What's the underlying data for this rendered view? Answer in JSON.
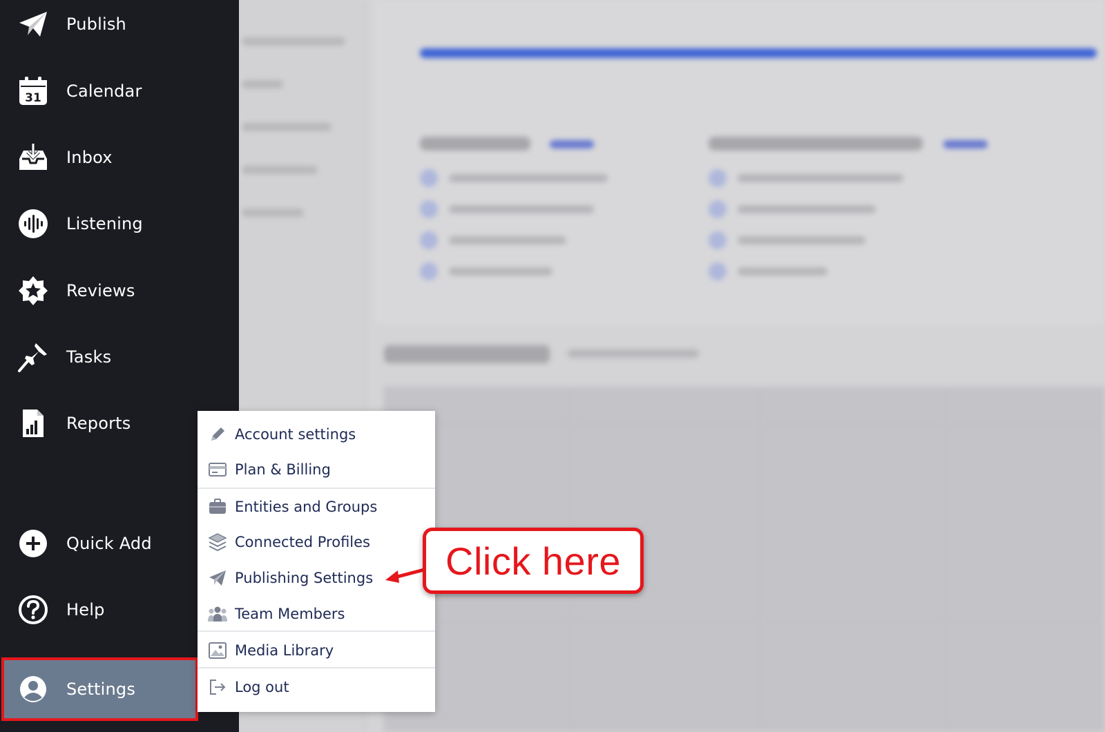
{
  "sidebar": {
    "items": [
      {
        "label": "Publish",
        "icon": "paper-plane-icon"
      },
      {
        "label": "Calendar",
        "icon": "calendar-icon",
        "badge": "31"
      },
      {
        "label": "Inbox",
        "icon": "inbox-icon"
      },
      {
        "label": "Listening",
        "icon": "sound-wave-icon"
      },
      {
        "label": "Reviews",
        "icon": "star-icon"
      },
      {
        "label": "Tasks",
        "icon": "pushpin-icon"
      },
      {
        "label": "Reports",
        "icon": "report-chart-icon"
      }
    ],
    "quick_add": {
      "label": "Quick Add",
      "icon": "plus-circle-icon"
    },
    "help": {
      "label": "Help",
      "icon": "question-circle-icon"
    },
    "settings": {
      "label": "Settings",
      "icon": "user-circle-icon",
      "highlight_color": "#e5171c"
    }
  },
  "settings_menu": {
    "items": [
      {
        "label": "Account settings",
        "icon": "pencil-icon"
      },
      {
        "label": "Plan & Billing",
        "icon": "credit-card-icon"
      },
      {
        "label": "Entities and Groups",
        "icon": "briefcase-icon"
      },
      {
        "label": "Connected Profiles",
        "icon": "layers-icon"
      },
      {
        "label": "Publishing Settings",
        "icon": "paper-plane-icon"
      },
      {
        "label": "Team Members",
        "icon": "users-icon"
      },
      {
        "label": "Media Library",
        "icon": "image-icon"
      },
      {
        "label": "Log out",
        "icon": "logout-icon"
      }
    ]
  },
  "callout": {
    "text": "Click here",
    "color": "#e5171c"
  },
  "colors": {
    "sidebar_bg": "#1b1c22",
    "settings_bg": "#6b7b8f",
    "menu_text": "#1e2a55",
    "accent_blue": "#3d63d6"
  }
}
